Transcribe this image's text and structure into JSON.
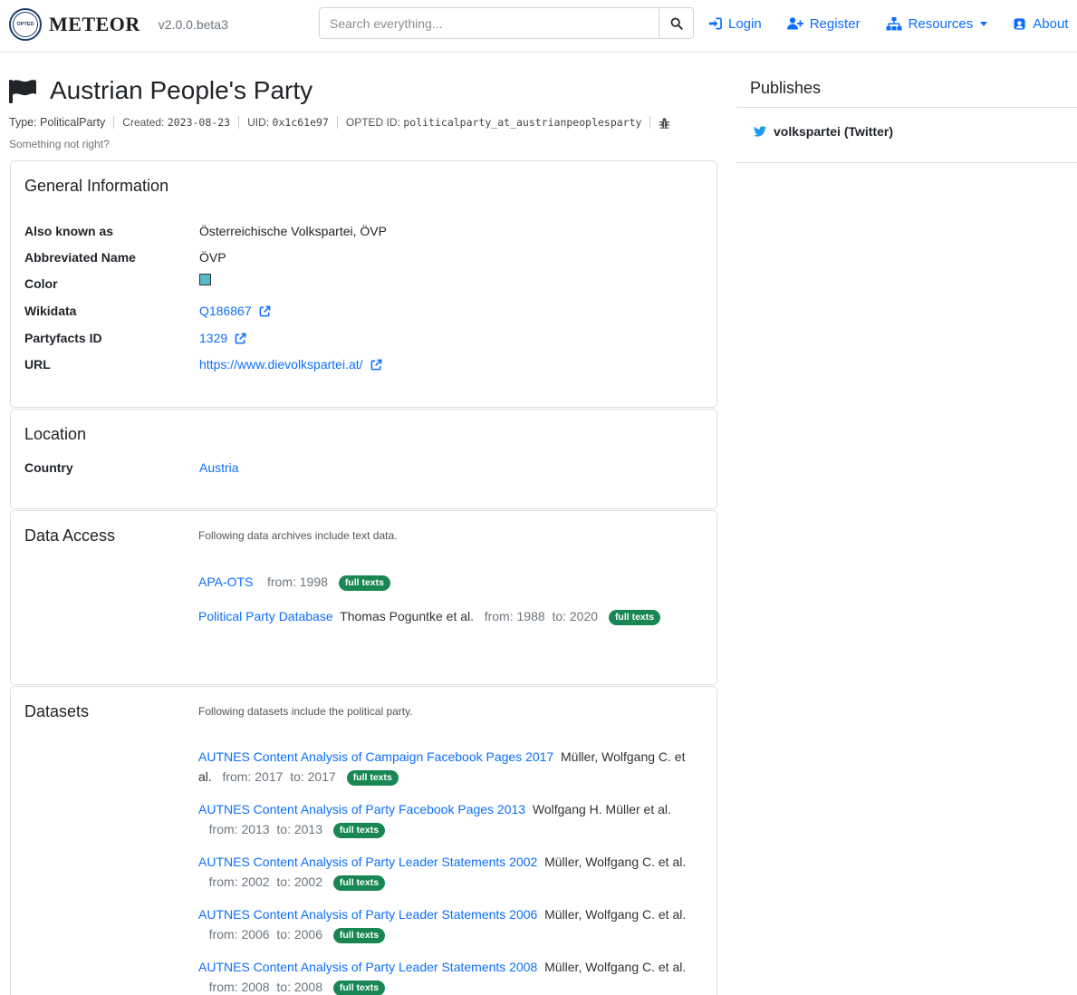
{
  "nav": {
    "brand": "METEOR",
    "logo_text": "OPTED",
    "version": "v2.0.0.beta3",
    "search_placeholder": "Search everything...",
    "login": "Login",
    "register": "Register",
    "resources": "Resources",
    "about": "About"
  },
  "header": {
    "title": "Austrian People's Party",
    "type_label": "Type: PoliticalParty",
    "created_label": "Created:",
    "created_value": "2023-08-23",
    "uid_label": "UID:",
    "uid_value": "0x1c61e97",
    "opted_label": "OPTED ID:",
    "opted_value": "politicalparty_at_austrianpeoplesparty",
    "not_right": "Something not right?"
  },
  "general": {
    "title": "General Information",
    "rows": [
      {
        "label": "Also known as",
        "value": "Österreichische Volkspartei, ÖVP"
      },
      {
        "label": "Abbreviated Name",
        "value": "ÖVP"
      },
      {
        "label": "Color",
        "value": ""
      },
      {
        "label": "Wikidata",
        "value": "Q186867"
      },
      {
        "label": "Partyfacts ID",
        "value": "1329"
      },
      {
        "label": "URL",
        "value": "https://www.dievolkspartei.at/"
      }
    ],
    "color_hex": "#5ab9c8"
  },
  "location": {
    "title": "Location",
    "country_label": "Country",
    "country_value": "Austria"
  },
  "data_access": {
    "title": "Data Access",
    "intro": "Following data archives include text data.",
    "items": [
      {
        "name": "APA-OTS",
        "authors": "",
        "from": "from: 1998",
        "to": "",
        "badge": "full texts"
      },
      {
        "name": "Political Party Database",
        "authors": "Thomas Poguntke et al.",
        "from": "from: 1988",
        "to": "to: 2020",
        "badge": "full texts"
      }
    ]
  },
  "datasets": {
    "title": "Datasets",
    "intro": "Following datasets include the political party.",
    "items": [
      {
        "name": "AUTNES Content Analysis of Campaign Facebook Pages 2017",
        "authors": "Müller, Wolfgang C. et al.",
        "from": "from: 2017",
        "to": "to: 2017",
        "badge": "full texts"
      },
      {
        "name": "AUTNES Content Analysis of Party Facebook Pages 2013",
        "authors": "Wolfgang H. Müller et al.",
        "from": "from: 2013",
        "to": "to: 2013",
        "badge": "full texts"
      },
      {
        "name": "AUTNES Content Analysis of Party Leader Statements 2002",
        "authors": "Müller, Wolfgang C. et al.",
        "from": "from: 2002",
        "to": "to: 2002",
        "badge": "full texts"
      },
      {
        "name": "AUTNES Content Analysis of Party Leader Statements 2006",
        "authors": "Müller, Wolfgang C. et al.",
        "from": "from: 2006",
        "to": "to: 2006",
        "badge": "full texts"
      },
      {
        "name": "AUTNES Content Analysis of Party Leader Statements 2008",
        "authors": "Müller, Wolfgang C. et al.",
        "from": "from: 2008",
        "to": "to: 2008",
        "badge": "full texts"
      }
    ]
  },
  "sidebar": {
    "title": "Publishes",
    "items": [
      {
        "label": "volkspartei (Twitter)"
      }
    ]
  },
  "colors": {
    "link": "#0d6efd",
    "badge": "#198754",
    "twitter": "#1d9bf0"
  }
}
